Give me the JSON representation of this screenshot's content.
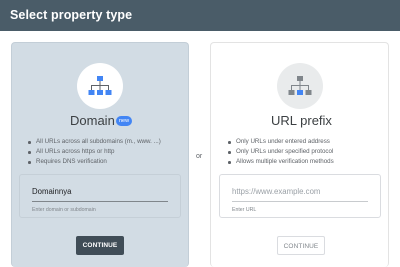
{
  "header": {
    "title": "Select property type"
  },
  "domain_card": {
    "icon": "sitemap-icon",
    "title": "Domain",
    "badge": "new",
    "bullets": [
      "All URLs across all subdomains (m., www. ...)",
      "All URLs across https or http",
      "Requires DNS verification"
    ],
    "input": {
      "value": "Domainnya",
      "helper": "Enter domain or subdomain"
    },
    "button": "CONTINUE"
  },
  "separator": "or",
  "url_card": {
    "icon": "sitemap-icon",
    "title": "URL prefix",
    "bullets": [
      "Only URLs under entered address",
      "Only URLs under specified protocol",
      "Allows multiple verification methods"
    ],
    "input": {
      "placeholder": "https://www.example.com",
      "helper": "Enter URL"
    },
    "button": "CONTINUE"
  },
  "colors": {
    "header_bg": "#4a5c68",
    "selected_card_bg": "#d2dce4",
    "accent_blue": "#4285f4",
    "primary_button": "#404d57"
  }
}
